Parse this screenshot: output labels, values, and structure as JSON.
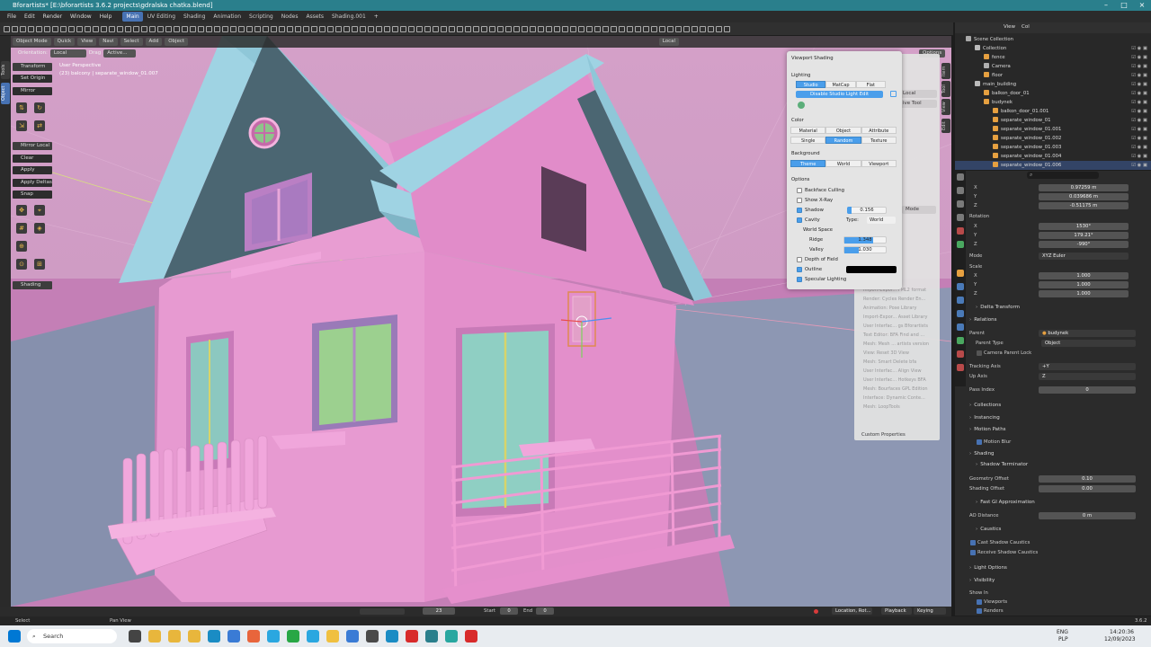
{
  "title": "Bforartists* [E:\\bforartists 3.6.2 projects\\gdralska chatka.blend]",
  "menu": [
    "File",
    "Edit",
    "Render",
    "Window",
    "Help"
  ],
  "workspaces": [
    "Main",
    "UV Editing",
    "Shading",
    "Animation",
    "Scripting",
    "Nodes",
    "Assets",
    "Shading.001"
  ],
  "active_workspace": "Main",
  "header": {
    "mode": "Object Mode",
    "quick": "Quick",
    "view": "View",
    "navi": "Navi",
    "select": "Select",
    "add": "Add",
    "object": "Object",
    "orientation_label": "Orientation:",
    "orientation": "Local",
    "drag_label": "Drag",
    "drag": "Active...",
    "pivot": "Local",
    "options": "Options"
  },
  "viewport": {
    "line1": "User Perspective",
    "line2": "(23) balcony | separate_window_01.007"
  },
  "left_tabs": [
    "Tools",
    "Object"
  ],
  "operators": {
    "transform": "Transform",
    "set_origin": "Set Origin",
    "mirror": "Mirror",
    "mirror_local": "Mirror Local",
    "clear": "Clear",
    "apply": "Apply",
    "apply_deltas": "Apply Deltas",
    "snap": "Snap",
    "shading": "Shading"
  },
  "shading_popup": {
    "title": "Viewport Shading",
    "lighting_label": "Lighting",
    "lighting": [
      "Studio",
      "MatCap",
      "Flat"
    ],
    "lighting_active": "Studio",
    "studio_btn": "Disable Studio Light Edit",
    "color_label": "Color",
    "color_row1": [
      "Material",
      "Object",
      "Attribute"
    ],
    "color_row2": [
      "Single",
      "Random",
      "Texture"
    ],
    "color_active": "Random",
    "background_label": "Background",
    "background": [
      "Theme",
      "World",
      "Viewport"
    ],
    "background_active": "Theme",
    "options_label": "Options",
    "backface": "Backface Culling",
    "xray": "Show X-Ray",
    "shadow": "Shadow",
    "shadow_value": "0.156",
    "cavity": "Cavity",
    "type_label": "Type:",
    "type_value": "World",
    "world_space": "World Space",
    "ridge": "Ridge",
    "ridge_value": "1.348",
    "valley": "Valley",
    "valley_value": "1.030",
    "dof": "Depth of Field",
    "outline": "Outline",
    "specular": "Specular Lighting"
  },
  "bg_panel_items": [
    "...BVH) format",
    "...gltf 1.1 format",
    "...STL format",
    "...UV Layout",
    "...FBX format",
    "...gtf 2.0 for...",
    "Import-Expor... FML2 format",
    "Render: Cycles Render En...",
    "Animation: Pose Library",
    "Import-Expor... Asset Library",
    "User Interfac... gs Bforartists",
    "Text Editor: BFA Find and ...",
    "Mesh: Mesh ... artists version",
    "View: Reset 3D View",
    "Mesh: Smart Delete bfa",
    "User Interfac... Align View",
    "User Interfac... Hotkeys BFA",
    "Mesh: Bourfaces GPL Edition",
    "Interface: Dynamic Conte...",
    "Mesh: LoopTools"
  ],
  "custom_properties": "Custom Properties",
  "bg_panel_mode": "Mode",
  "bg_panel_local": "Local",
  "bg_panel_tool": "ive Tool",
  "right_tabs": [
    "Item",
    "Tool",
    "View",
    "Edit"
  ],
  "outliner": {
    "tabs": [
      "View",
      "Col"
    ],
    "items": [
      {
        "label": "Scene Collection",
        "indent": 0,
        "kind": "scene"
      },
      {
        "label": "Collection",
        "indent": 1,
        "kind": "coll"
      },
      {
        "label": "fence",
        "indent": 2,
        "kind": "obj"
      },
      {
        "label": "Camera",
        "indent": 2,
        "kind": "cam"
      },
      {
        "label": "floor",
        "indent": 2,
        "kind": "obj"
      },
      {
        "label": "main_building",
        "indent": 1,
        "kind": "coll"
      },
      {
        "label": "balkon_door_01",
        "indent": 2,
        "kind": "obj"
      },
      {
        "label": "budynek",
        "indent": 2,
        "kind": "obj"
      },
      {
        "label": "balkon_door_01.001",
        "indent": 3,
        "kind": "obj"
      },
      {
        "label": "separate_window_01",
        "indent": 3,
        "kind": "obj"
      },
      {
        "label": "separate_window_01.001",
        "indent": 3,
        "kind": "obj"
      },
      {
        "label": "separate_window_01.002",
        "indent": 3,
        "kind": "obj"
      },
      {
        "label": "separate_window_01.003",
        "indent": 3,
        "kind": "obj"
      },
      {
        "label": "separate_window_01.004",
        "indent": 3,
        "kind": "obj"
      },
      {
        "label": "separate_window_01.006",
        "indent": 3,
        "kind": "obj"
      }
    ]
  },
  "props": {
    "location": {
      "x": "0.97259 m",
      "y": "0.039686 m",
      "z": "-0.51175 m"
    },
    "rotation_label": "Rotation",
    "rotation": {
      "x": "1530°",
      "y": "179.21°",
      "z": "-990°"
    },
    "mode_label": "Mode",
    "mode": "XYZ Euler",
    "scale_label": "Scale",
    "scale": {
      "x": "1.000",
      "y": "1.000",
      "z": "1.000"
    },
    "delta": "Delta Transform",
    "relations": "Relations",
    "parent_label": "Parent",
    "parent": "budynek",
    "parent_type_label": "Parent Type",
    "parent_type": "Object",
    "camera_lock": "Camera Parent Lock",
    "tracking_label": "Tracking Axis",
    "tracking": "+Y",
    "up_label": "Up Axis",
    "up": "Z",
    "pass_label": "Pass Index",
    "pass": "0",
    "collections": "Collections",
    "instancing": "Instancing",
    "motion_paths": "Motion Paths",
    "motion_blur": "Motion Blur",
    "shading": "Shading",
    "shadow_terminator": "Shadow Terminator",
    "geo_offset_label": "Geometry Offset",
    "geo_offset": "0.10",
    "shading_offset_label": "Shading Offset",
    "shading_offset": "0.00",
    "fast_gi": "Fast GI Approximation",
    "ao_label": "AO Distance",
    "ao": "0 m",
    "caustics": "Caustics",
    "cast_caustics": "Cast Shadow Caustics",
    "recv_caustics": "Receive Shadow Caustics",
    "light_options": "Light Options",
    "visibility": "Visibility",
    "show_in": "Show In",
    "viewports": "Viewports",
    "renders": "Renders",
    "axis_x": "X",
    "axis_y": "Y",
    "axis_z": "Z"
  },
  "timeline": {
    "frame": "23",
    "start_label": "Start",
    "start": "0",
    "end_label": "End",
    "end": "0",
    "keyset": "Location, Rot...",
    "playback": "Playback",
    "keying": "Keying"
  },
  "status": {
    "left": "Select",
    "mid": "Pan View",
    "version": "3.6.2"
  },
  "taskbar": {
    "search": "Search",
    "lang1": "ENG",
    "lang2": "PLP",
    "time": "14:20:36",
    "date": "12/09/2023"
  },
  "colors": {
    "accent": "#4a9eeb",
    "wall": "#e79ad1",
    "roof": "#8fc7d8",
    "titlebar": "#2a7f8c"
  }
}
